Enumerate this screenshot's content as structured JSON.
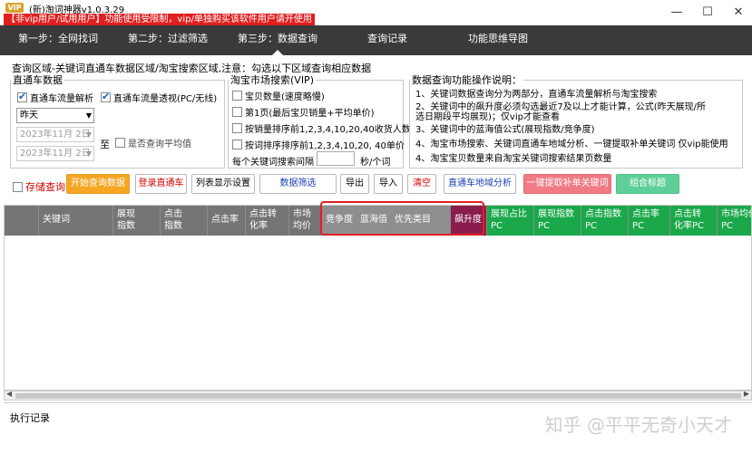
{
  "window": {
    "logo": "VIP",
    "title": "(新)淘词神器v1.0.3.29",
    "warning": "【非vip用户/试用用户】功能使用受限制，vip/单独购买该软件用户请开使用",
    "minimize": "—",
    "maximize": "☐",
    "close": "✕"
  },
  "nav": [
    "第一步：全网找词",
    "第二步：过滤筛选",
    "第三步：数据查询",
    "查询记录",
    "功能思维导图"
  ],
  "section_title": "查询区域-关键词直通车数据区域/淘宝搜索区域,注意：勾选以下区域查询相应数据",
  "ztc": {
    "legend": "直通车数据",
    "cb1": "直通车流量解析",
    "cb2": "直通车流量透视(PC/无线)",
    "period": "昨天",
    "date1": "2023年11月 2日",
    "date2": "2023年11月 2日",
    "to": "至",
    "cb_avg": "是否查询平均值"
  },
  "tb": {
    "legend": "淘宝市场搜索(VIP)",
    "cb1": "宝贝数量(速度略慢)",
    "cb2": "第1页(最后宝贝销量+平均单价)",
    "cb3": "按销量排序前1,2,3,4,10,20,40收货人数",
    "cb4": "按词排序排序前1,2,3,4,10,20, 40单价",
    "interval_label": "每个关键词搜索间隔",
    "interval_unit": "秒/个词"
  },
  "info": {
    "title": "数据查询功能操作说明：",
    "lines": [
      "1、关键词数据查询分为两部分，直通车流量解析与淘宝搜索",
      "2、关键词中的飙升度必须勾选最近7及以上才能计算，公式(昨天展现/所",
      "选日期段平均展现)；仅vip才能查看",
      "3、关键词中的蓝海值公式(展现指数/竞争度)",
      "4、淘宝市场搜索、关键词直通车地域分析、一键提取补单关键词 仅vip能使用",
      "4、淘宝宝贝数量来自淘宝关键词搜索结果页数量"
    ]
  },
  "toolbar": {
    "store_query": "存储查询",
    "start": "开始查询数据",
    "login": "登录直通车",
    "list_settings": "列表显示设置",
    "filter": "数据筛选",
    "export": "导出",
    "import": "导入",
    "clear": "清空",
    "region": "直通车地域分析",
    "extract": "一键提取补单关键词",
    "combine": "组合标题"
  },
  "columns": [
    {
      "label": "",
      "style": "plain"
    },
    {
      "label": "关键词",
      "style": "plain"
    },
    {
      "label": "展现\n指数",
      "style": "plain"
    },
    {
      "label": "点击\n指数",
      "style": "plain"
    },
    {
      "label": "点击率",
      "style": "plain"
    },
    {
      "label": "点击转\n化率",
      "style": "plain"
    },
    {
      "label": "市场\n均价",
      "style": "plain"
    },
    {
      "label": "竞争度",
      "style": "gray2"
    },
    {
      "label": "蓝海值",
      "style": "gray2"
    },
    {
      "label": "优先类目",
      "style": "gray2"
    },
    {
      "label": "飙升度",
      "style": "mag"
    },
    {
      "label": "展现占比\nPC",
      "style": "green"
    },
    {
      "label": "展现指数\nPC",
      "style": "green"
    },
    {
      "label": "点击指数\nPC",
      "style": "green"
    },
    {
      "label": "点击率\nPC",
      "style": "green"
    },
    {
      "label": "点击转\n化率PC",
      "style": "green"
    },
    {
      "label": "市场均价\nPC",
      "style": "green"
    }
  ],
  "log_title": "执行记录",
  "watermark": "知乎 @平平无奇小天才",
  "colors": {
    "nav_bg": "#3a3a3a",
    "header_bg": "#757575",
    "green_col": "#1aa84a",
    "mag_col": "#8a1d4d",
    "highlight": "#e02020"
  }
}
